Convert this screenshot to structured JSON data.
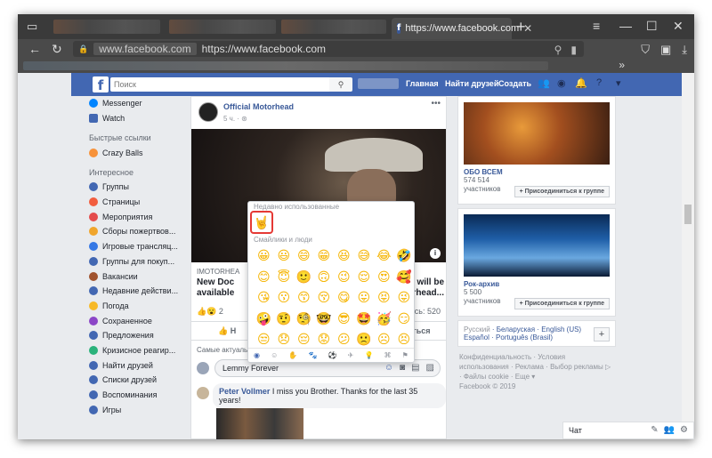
{
  "browser": {
    "active_tab_title": "https://www.facebook.com",
    "tab_close": "✕",
    "new_tab": "+",
    "address_domain": "www.facebook.com",
    "address_url": "https://www.facebook.com",
    "bookmarks_more": "»"
  },
  "header": {
    "logo": "f",
    "search_placeholder": "Поиск",
    "nav_home": "Главная",
    "nav_find_friends": "Найти друзей",
    "nav_create": "Создать"
  },
  "sidebar": {
    "top_items": [
      {
        "label": "Messenger",
        "color": "#0084ff"
      },
      {
        "label": "Watch",
        "color": "#4267b2"
      }
    ],
    "quick_links_head": "Быстрые ссылки",
    "quick_links": [
      {
        "label": "Crazy Balls",
        "color": "#f7923a"
      }
    ],
    "interesting_head": "Интересное",
    "interesting": [
      {
        "label": "Группы",
        "color": "#4267b2"
      },
      {
        "label": "Страницы",
        "color": "#f25d3e"
      },
      {
        "label": "Мероприятия",
        "color": "#e44b4b"
      },
      {
        "label": "Сборы пожертвов...",
        "color": "#f0a52c"
      },
      {
        "label": "Игровые трансляц...",
        "color": "#3578e5"
      },
      {
        "label": "Группы для покуп...",
        "color": "#4267b2"
      },
      {
        "label": "Вакансии",
        "color": "#a0522d"
      },
      {
        "label": "Недавние действи...",
        "color": "#4267b2"
      },
      {
        "label": "Погода",
        "color": "#f7b928"
      },
      {
        "label": "Сохраненное",
        "color": "#8c46c7"
      },
      {
        "label": "Предложения",
        "color": "#4267b2"
      },
      {
        "label": "Кризисное реагир...",
        "color": "#2ab27b"
      },
      {
        "label": "Найти друзей",
        "color": "#4267b2"
      },
      {
        "label": "Списки друзей",
        "color": "#4267b2"
      },
      {
        "label": "Воспоминания",
        "color": "#4267b2"
      },
      {
        "label": "Игры",
        "color": "#4267b2"
      }
    ]
  },
  "post": {
    "page_name": "Official Motorhead",
    "time": "5 ч. · ⊛",
    "more": "•••",
    "link_source": "IMOTORHEA",
    "link_title_left": "New Doc",
    "link_title_left2": "available",
    "link_title_right": "will be",
    "link_title_right2": "otorhead...",
    "reactions": "👍😮 2",
    "shares": "делились: 520",
    "action_like": "Н",
    "action_share": "елиться",
    "comments_head": "Самые актуаль",
    "comment_input_value": "Lemmy Forever",
    "comment_author": "Peter Vollmer",
    "comment_text": "I miss you Brother. Thanks for the last 35 years!"
  },
  "emoji_picker": {
    "recent_head": "Недавно использованные",
    "recent": "🤘",
    "smileys_head": "Смайлики и люди",
    "emojis": [
      "😀",
      "😃",
      "😄",
      "😁",
      "😆",
      "😅",
      "😂",
      "🤣",
      "😊",
      "😇",
      "🙂",
      "🙃",
      "😉",
      "😌",
      "😍",
      "🥰",
      "😘",
      "😗",
      "😙",
      "😚",
      "😋",
      "😛",
      "😝",
      "😜",
      "🤪",
      "🤨",
      "🧐",
      "🤓",
      "😎",
      "🤩",
      "🥳",
      "😏",
      "😒",
      "😞",
      "😔",
      "😟",
      "😕",
      "🙁",
      "☹",
      "😣"
    ]
  },
  "right": {
    "group1_name": "ОБО ВСЕМ",
    "group1_members": "574 514",
    "group1_members_label": "участников",
    "join_label": "+ Присоединиться к группе",
    "group2_name": "Рок-архив",
    "group2_members": "5 500",
    "group2_members_label": "участников",
    "lang_current": "Русский",
    "lang_1": "Беларуская",
    "lang_2": "English (US)",
    "lang_3": "Español",
    "lang_4": "Português (Brasil)",
    "lang_plus": "+",
    "footer_line1": "Конфиденциальность · Условия",
    "footer_line2": "использования · Реклама · Выбор рекламы ▷",
    "footer_line3": "· Файлы cookie · Еще ▾",
    "footer_line4": "Facebook © 2019"
  },
  "chat": {
    "label": "Чат"
  }
}
